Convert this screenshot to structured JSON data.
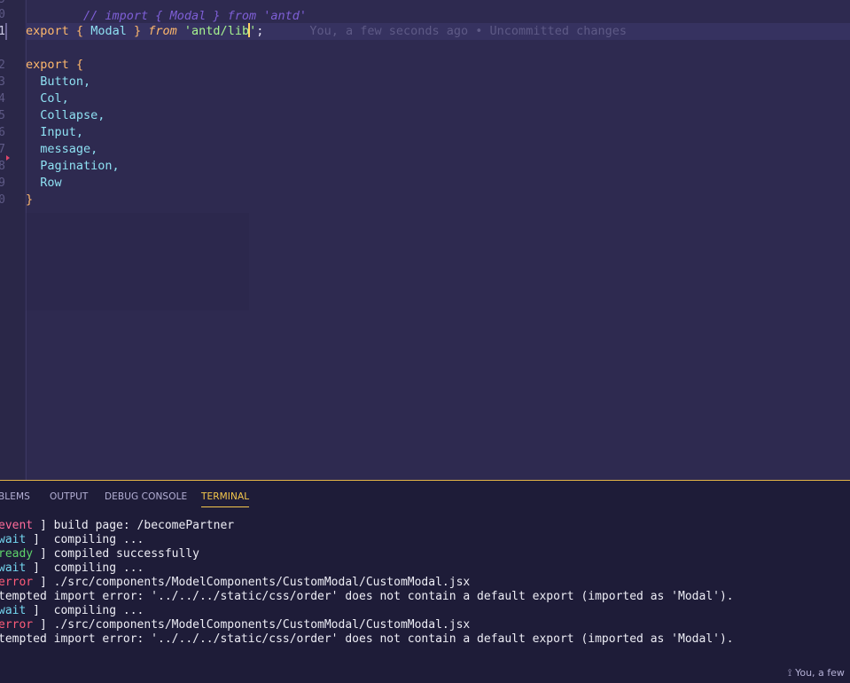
{
  "editor": {
    "gutter_numbers": [
      "9",
      "0",
      "1",
      "2",
      "3",
      "4",
      "5",
      "6",
      "7",
      "8",
      "9",
      "0"
    ],
    "lines": {
      "comment": "// import { Modal } from 'antd'",
      "l2_kw": "export",
      "l2_open": "{",
      "l2_id": "Modal",
      "l2_close": "}",
      "l2_from": "from",
      "l2_str_a": "'antd/lib",
      "l2_str_b": "'",
      "l2_semi": ";",
      "blame": "You, a few seconds ago • Uncommitted changes",
      "l4_kw": "export",
      "l4_open": "{",
      "items": [
        "Button,",
        "Col,",
        "Collapse,",
        "Input,",
        "message,",
        "Pagination,",
        "Row"
      ],
      "close": "}"
    }
  },
  "panel": {
    "tabs": [
      "BLEMS",
      "OUTPUT",
      "DEBUG CONSOLE",
      "TERMINAL"
    ],
    "active_tab": "TERMINAL",
    "terminal_lines": [
      {
        "tag": "event",
        "text": " ] build page: /becomePartner"
      },
      {
        "tag": "wait",
        "text": " ]  compiling ..."
      },
      {
        "tag": "ready",
        "text": " ] compiled successfully"
      },
      {
        "tag": "wait",
        "text": " ]  compiling ..."
      },
      {
        "tag": "error",
        "text": " ] ./src/components/ModelComponents/CustomModal/CustomModal.jsx"
      },
      {
        "tag": "",
        "text": "tempted import error: '../../../static/css/order' does not contain a default export (imported as 'Modal')."
      },
      {
        "tag": "wait",
        "text": " ]  compiling ..."
      },
      {
        "tag": "error",
        "text": " ] ./src/components/ModelComponents/CustomModal/CustomModal.jsx"
      },
      {
        "tag": "",
        "text": "tempted import error: '../../../static/css/order' does not contain a default export (imported as 'Modal')."
      }
    ]
  },
  "status_bar": {
    "blame": "You, a few"
  },
  "colors": {
    "editor_bg": "#2e2a50",
    "panel_bg": "#1e1c38",
    "panel_border": "#e3b448",
    "keyword": "#ffb86c",
    "identifier": "#8ee0f2",
    "string": "#a6f28f",
    "event": "#ff6b9a",
    "wait": "#73d6ef",
    "ready": "#5ed36a",
    "error": "#ff5c79"
  },
  "icons": [
    "git-commit-icon",
    "breakpoint-arrow-icon"
  ]
}
